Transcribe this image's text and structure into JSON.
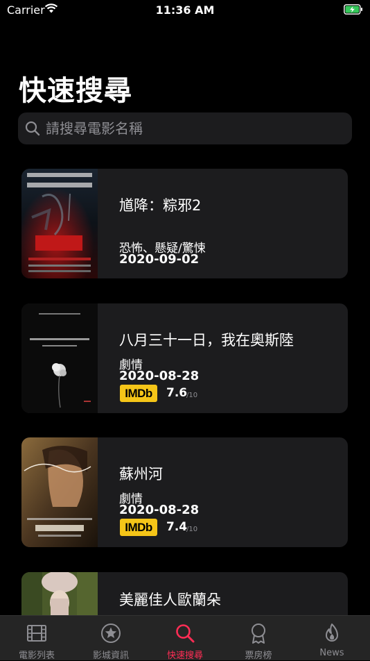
{
  "status_bar": {
    "carrier": "Carrier",
    "time": "11:36 AM"
  },
  "page_title": "快速搜尋",
  "search": {
    "placeholder": "請搜尋電影名稱",
    "value": ""
  },
  "movies": [
    {
      "title": "馗降：粽邪2",
      "genre": "恐怖、懸疑/驚悚",
      "date": "2020-09-02"
    },
    {
      "title": "八月三十一日，我在奧斯陸",
      "genre": "劇情",
      "date": "2020-08-28",
      "imdb_label": "IMDb",
      "imdb_score": "7.6",
      "imdb_max": "/10"
    },
    {
      "title": "蘇州河",
      "genre": "劇情",
      "date": "2020-08-28",
      "imdb_label": "IMDb",
      "imdb_score": "7.4",
      "imdb_max": "/10"
    },
    {
      "title": "美麗佳人歐蘭朵"
    }
  ],
  "tabs": [
    {
      "label": "電影列表",
      "icon": "film-icon",
      "active": false
    },
    {
      "label": "影城資訊",
      "icon": "star-icon",
      "active": false
    },
    {
      "label": "快速搜尋",
      "icon": "search-icon",
      "active": true
    },
    {
      "label": "票房榜",
      "icon": "award-icon",
      "active": false
    },
    {
      "label": "News",
      "icon": "flame-icon",
      "active": false
    }
  ],
  "colors": {
    "accent": "#ff2d55",
    "card": "#1c1c1e",
    "imdb": "#f5c518",
    "battery": "#34c759"
  }
}
